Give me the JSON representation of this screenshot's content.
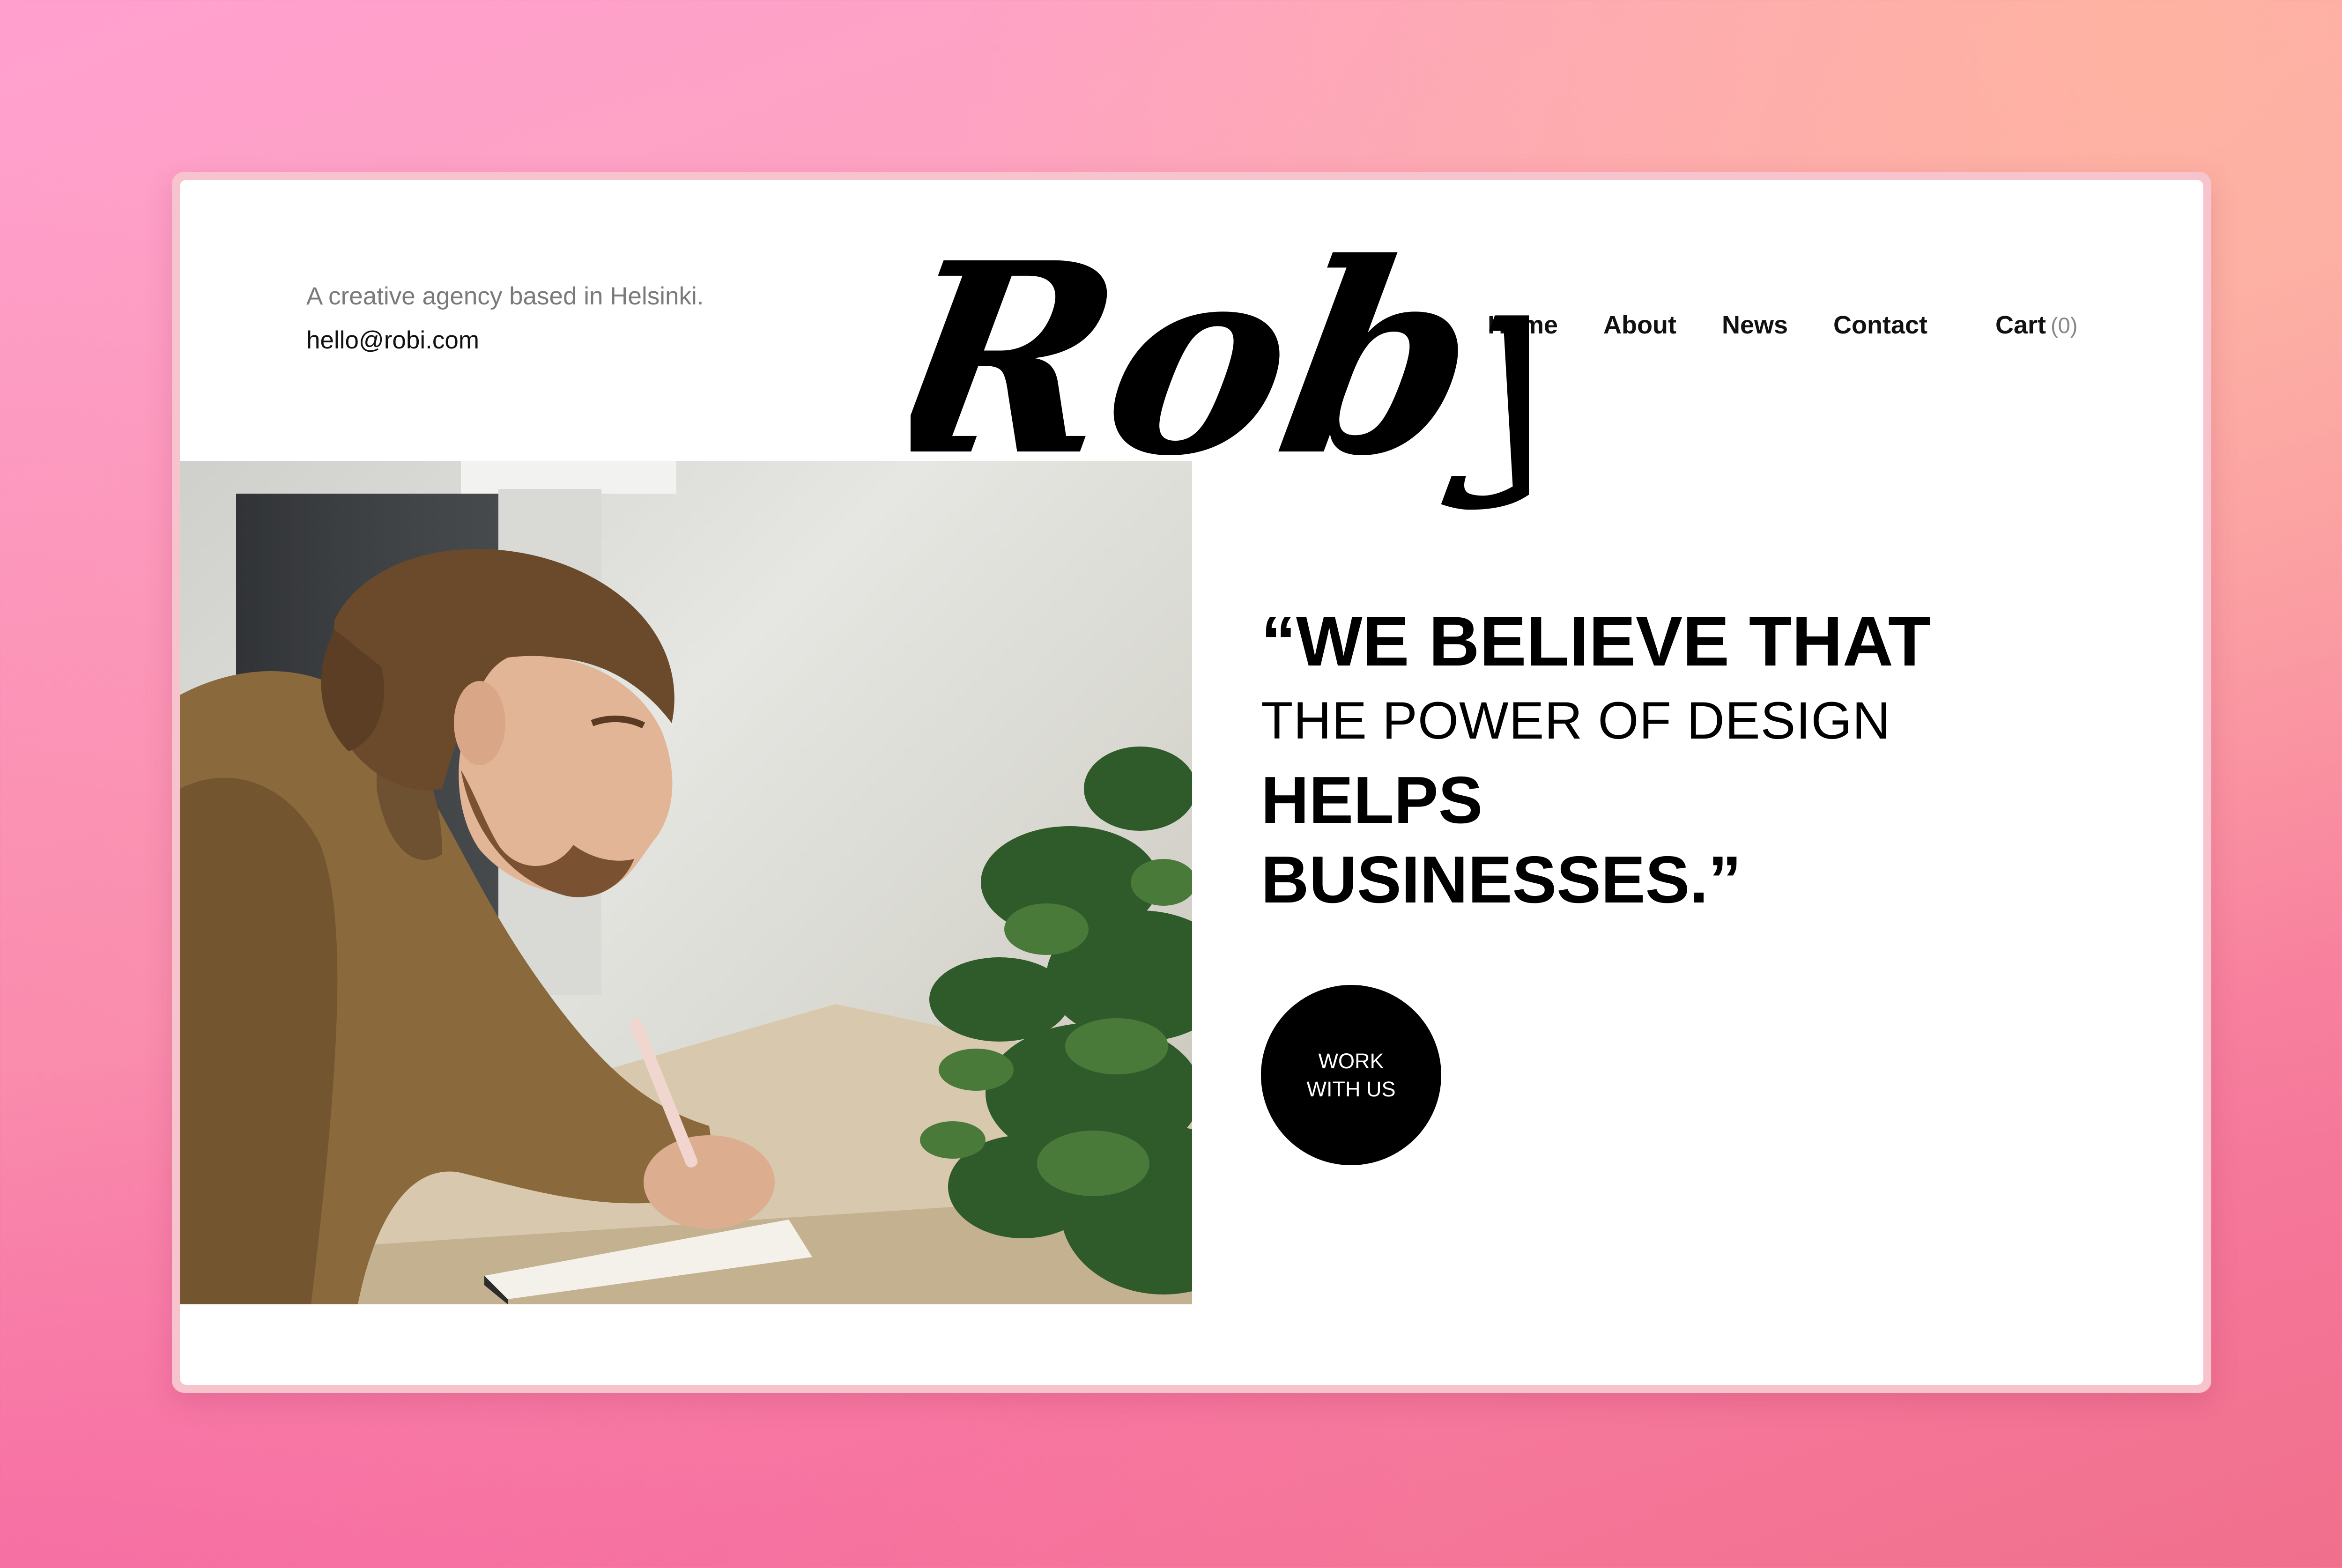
{
  "header": {
    "tagline": "A creative agency based in Helsinki.",
    "email": "hello@robi.com",
    "logo_text": "Roby"
  },
  "nav": {
    "items": [
      {
        "label": "Home"
      },
      {
        "label": "About"
      },
      {
        "label": "News"
      },
      {
        "label": "Contact"
      }
    ],
    "cart_label": "Cart",
    "cart_count": "(0)"
  },
  "hero": {
    "quote_line1": "“WE BELIEVE THAT",
    "quote_line2": "THE POWER OF DESIGN",
    "quote_line3": "HELPS",
    "quote_line4": "BUSINESSES.”",
    "cta_line1": "WORK",
    "cta_line2": "WITH US"
  },
  "colors": {
    "accent": "#000000",
    "background_gradient_start": "#ff9fcf",
    "background_gradient_end": "#f06f8c"
  }
}
